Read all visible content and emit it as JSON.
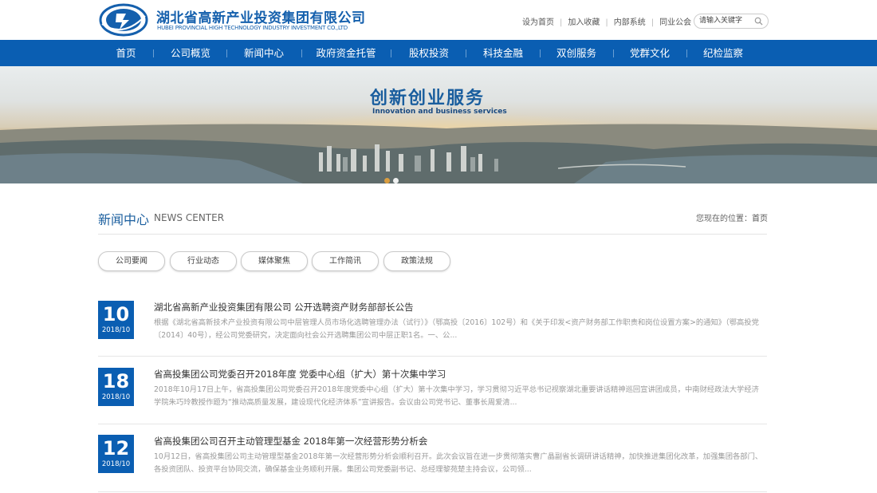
{
  "header": {
    "brand_cn": "湖北省高新产业投资集团有限公司",
    "brand_en": "HUBEI PROVINCIAL HIGH TECHNOLOGY INDUSTRY INVESTMENT CO.,LTD",
    "top_links": [
      "设为首页",
      "加入收藏",
      "内部系统",
      "同业公会"
    ],
    "search_placeholder": "请输入关键字",
    "colors": {
      "brand": "#1560ad",
      "nav_bg": "#0a5eb2"
    }
  },
  "nav": {
    "items": [
      "首页",
      "公司概览",
      "新闻中心",
      "政府资金托管",
      "股权投资",
      "科技金融",
      "双创服务",
      "党群文化",
      "纪检监察"
    ]
  },
  "banner": {
    "title": "创新创业服务",
    "subtitle": "Innovation and business services",
    "slide_count": 2,
    "active_slide": 1
  },
  "section": {
    "title": "新闻中心",
    "title_en": "NEWS CENTER",
    "breadcrumb_label": "您现在的位置：",
    "breadcrumb_home": "首页"
  },
  "tabs": [
    "公司要闻",
    "行业动态",
    "媒体聚焦",
    "工作简讯",
    "政策法规"
  ],
  "news": [
    {
      "day": "10",
      "year_month": "2018/10",
      "title": "湖北省高新产业投资集团有限公司 公开选聘资产财务部部长公告",
      "summary": "根据《湖北省高新技术产业投资有限公司中层管理人员市场化选聘管理办法（试行）》（鄂高投〔2016〕102号）和《关于印发<资产财务部工作职责和岗位设置方案>的通知》（鄂高投党〔2014〕40号），经公司党委研究，决定面向社会公开选聘集团公司中层正职1名。一、公..."
    },
    {
      "day": "18",
      "year_month": "2018/10",
      "title": "省高投集团公司党委召开2018年度 党委中心组（扩大）第十次集中学习",
      "summary": "2018年10月17日上午，省高投集团公司党委召开2018年度党委中心组（扩大）第十次集中学习，学习贯彻习近平总书记视察湖北重要讲话精神巡回宣讲团成员，中南财经政法大学经济学院朱巧玲教授作题为“推动高质量发展，建设现代化经济体系”宣讲报告。会议由公司党书记、董事长周爱清..."
    },
    {
      "day": "12",
      "year_month": "2018/10",
      "title": "省高投集团公司召开主动管理型基金 2018年第一次经营形势分析会",
      "summary": "10月12日，省高投集团公司主动管理型基金2018年第一次经营形势分析会顺利召开。此次会议旨在进一步贯彻落实曹广晶副省长调研讲话精神，加快推进集团化改革，加强集团各部门、各投资团队、投资平台协同交流，确保基金业务顺利开展。集团公司党委副书记、总经理黎苑楚主持会议，公司领..."
    }
  ]
}
